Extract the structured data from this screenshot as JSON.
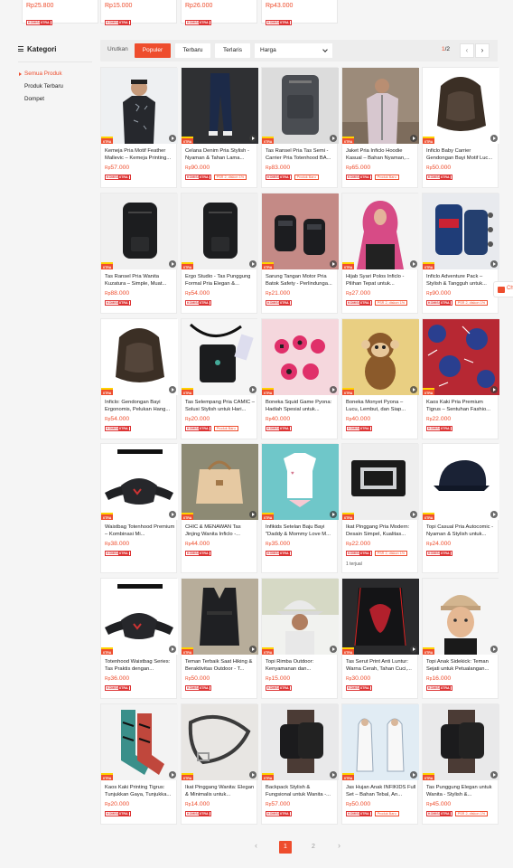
{
  "top_cards": [
    {
      "price": "25.800"
    },
    {
      "price": "15.000"
    },
    {
      "price": "26.000"
    },
    {
      "price": "43.000"
    }
  ],
  "sidebar": {
    "title": "Kategori",
    "items": [
      {
        "label": "Semua Produk",
        "active": true
      },
      {
        "label": "Produk Terbaru",
        "active": false
      },
      {
        "label": "Dompet",
        "active": false
      }
    ]
  },
  "sortbar": {
    "label": "Urutkan",
    "buttons": [
      "Populer",
      "Terbaru",
      "Terlaris"
    ],
    "price_select": "Harga",
    "page_current": "1",
    "page_total": "/2"
  },
  "labels": {
    "currency": "Rp",
    "extra_badge": "XTRA",
    "komisi_a": "KOMISI",
    "komisi_b": "XTRA"
  },
  "colors": {
    "accent": "#ee4d2d",
    "badge_red": "#d33",
    "background": "#f5f5f5"
  },
  "products": [
    {
      "title": "Kemeja Pria Motif Feather Mallevic – Kemeja Printing...",
      "price": "57.000",
      "tag": "",
      "sold": "",
      "icon": "shirt-man"
    },
    {
      "title": "Celana Denim Pria Stylish - Nyaman & Tahan Lama...",
      "price": "90.000",
      "tag": "PSR 2, diskon 1%",
      "sold": "",
      "icon": "jeans"
    },
    {
      "title": "Tas Ransel Pria Tas Semi - Carrier Pria Totenhood BA...",
      "price": "83.000",
      "tag": "Produk Baru",
      "sold": "",
      "icon": "backpack"
    },
    {
      "title": "Jaket Pria Inficlo Hoodie Kasual – Bahan Nyaman,...",
      "price": "65.000",
      "tag": "Produk Baru",
      "sold": "",
      "icon": "jacket"
    },
    {
      "title": "Inficlo Baby Carrier Gendongan Bayi Motif Luc...",
      "price": "50.000",
      "tag": "",
      "sold": "",
      "icon": "carrier"
    },
    {
      "title": "Tas Ransel Pria Wanita Kuzatura – Simple, Muat...",
      "price": "88.000",
      "tag": "",
      "sold": "",
      "icon": "backpack-black"
    },
    {
      "title": "Ergo Studio - Tas Punggung Formal Pria Elegan &...",
      "price": "54.000",
      "tag": "",
      "sold": "",
      "icon": "backpack-black"
    },
    {
      "title": "Sarung Tangan Motor Pria Batok Safety - Perlindunga...",
      "price": "21.000",
      "tag": "",
      "sold": "",
      "icon": "gloves"
    },
    {
      "title": "Hijab Syari Polos Inficlo - Pilihan Tepat untuk...",
      "price": "27.000",
      "tag": "PSR 2, diskon 1%",
      "sold": "",
      "icon": "hijab"
    },
    {
      "title": "Inficlo Adventure Pack – Stylish & Tangguh untuk...",
      "price": "90.000",
      "tag": "PSR 2, diskon 1%",
      "sold": "",
      "icon": "backpack-blue"
    },
    {
      "title": "Inficlo: Gendongan Bayi Ergonomis, Pelukan Hang...",
      "price": "54.000",
      "tag": "",
      "sold": "",
      "icon": "carrier"
    },
    {
      "title": "Tas Selempang Pria CAMIC – Solusi Stylish untuk Hari...",
      "price": "20.000",
      "tag": "Produk Baru",
      "sold": "",
      "icon": "sling"
    },
    {
      "title": "Boneka Squid Game Pyona: Hadiah Spesial untuk...",
      "price": "40.000",
      "tag": "",
      "sold": "",
      "icon": "dolls"
    },
    {
      "title": "Boneka Monyet Pyona – Lucu, Lembut, dan Siap...",
      "price": "40.000",
      "tag": "",
      "sold": "",
      "icon": "monkey"
    },
    {
      "title": "Kaos Kaki Pria Premium Tigrus – Sentuhan Fashio...",
      "price": "22.000",
      "tag": "",
      "sold": "",
      "icon": "pattern"
    },
    {
      "title": "Waistbag Totenhood Premium – Kombinasi Mi...",
      "price": "38.000",
      "tag": "",
      "sold": "",
      "icon": "waistbag"
    },
    {
      "title": "CHIC & MENAWAN Tas Jinjing Wanita Inficlo -...",
      "price": "44.000",
      "tag": "",
      "sold": "",
      "icon": "handbag"
    },
    {
      "title": "Infikids Setelan Baju Bayi \"Daddy & Mommy Love M...",
      "price": "35.000",
      "tag": "",
      "sold": "",
      "icon": "baby-clothes"
    },
    {
      "title": "Ikat Pinggang Pria Modern: Desain Simpel, Kualitas...",
      "price": "22.000",
      "tag": "PSR 2, diskon 1%",
      "sold": "1 terjual",
      "icon": "belt-black"
    },
    {
      "title": "Topi Casual Pria Autocomic - Nyaman & Stylish untuk...",
      "price": "24.000",
      "tag": "",
      "sold": "",
      "icon": "cap"
    },
    {
      "title": "Totenhood Waistbag Series: Tas Praktis dengan...",
      "price": "36.000",
      "tag": "",
      "sold": "",
      "icon": "waistbag"
    },
    {
      "title": "Teman Terbaik Saat Hiking & Beraktivitas Outdoor - T...",
      "price": "50.000",
      "tag": "",
      "sold": "",
      "icon": "vest"
    },
    {
      "title": "Topi Rimba Outdoor: Kenyamanan dan...",
      "price": "15.000",
      "tag": "",
      "sold": "",
      "icon": "bucket-hat"
    },
    {
      "title": "Tas Serut Print Anti Luntur: Warna Cerah, Tahan Cuci,...",
      "price": "30.000",
      "tag": "",
      "sold": "",
      "icon": "drawstring"
    },
    {
      "title": "Topi Anak Sidekick: Teman Sejati untuk Petualangan...",
      "price": "16.000",
      "tag": "",
      "sold": "",
      "icon": "kid-cap"
    },
    {
      "title": "Kaos Kaki Printing Tigrus: Tunjukkan Gaya, Tunjukka...",
      "price": "20.000",
      "tag": "",
      "sold": "",
      "icon": "socks"
    },
    {
      "title": "Ikat Pinggang Wanita: Elegan & Minimalis untuk...",
      "price": "14.000",
      "tag": "",
      "sold": "",
      "icon": "belt-thin"
    },
    {
      "title": "Backpack Stylish & Fungsional untuk Wanita -...",
      "price": "57.000",
      "tag": "",
      "sold": "",
      "icon": "backpack-woman"
    },
    {
      "title": "Jas Hujan Anak INFIKIDS Full Set – Bahan Tebal, An...",
      "price": "50.000",
      "tag": "Produk Baru",
      "sold": "",
      "icon": "raincoat"
    },
    {
      "title": "Tas Punggung Elegan untuk Wanita - Stylish &...",
      "price": "45.000",
      "tag": "PSR 2, diskon 1%",
      "sold": "",
      "icon": "backpack-woman"
    }
  ],
  "bottom_pager": {
    "prev": "‹",
    "next": "›",
    "pages": [
      "1",
      "2"
    ]
  },
  "chat": {
    "label": "Ch"
  }
}
